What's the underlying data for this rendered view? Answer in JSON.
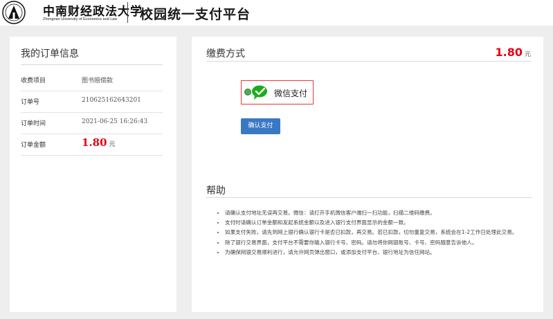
{
  "header": {
    "university_name_cn": "中南财经政法大学",
    "university_name_en": "Zhongnan University of Economics and Law",
    "platform_title": "校园统一支付平台"
  },
  "order_panel": {
    "title": "我的订单信息",
    "rows": [
      {
        "label": "收费项目",
        "value": "图书赔偿款"
      },
      {
        "label": "订单号",
        "value": "210625162643201"
      },
      {
        "label": "订单时间",
        "value": "2021-06-25 16:26:43"
      }
    ],
    "amount_label": "订单金额",
    "amount_value": "1.80",
    "amount_unit": "元"
  },
  "payment_panel": {
    "title": "缴费方式",
    "amount_value": "1.80",
    "amount_unit": "元",
    "method_label": "微信支付",
    "confirm_label": "确认支付"
  },
  "help": {
    "title": "帮助",
    "items": [
      "请确认支付地址无误再交易。微信：请打开手机微信客户端扫一扫功能，扫描二维码缴费。",
      "支付时请确认订单金额和发起系统金额以及进入银行支付界面显示的金额一致。",
      "如果支付失败，请先到网上银行确认银行卡是否已扣款，再交易。若已扣款，切勿重复交易，系统会在1-2工作日处理此交易。",
      "除了银行交易界面，支付平台不需要你输入银行卡号、密码。请勿将你网银账号、卡号、密码随意告诉他人。",
      "为确保网银交易顺利进行，请允许网页弹出窗口，或添加支付平台、银行地址为信任网站。"
    ]
  },
  "colors": {
    "accent_blue": "#3a78c4",
    "amount_red": "#e60012",
    "wechat_green": "#1aad19",
    "selection_border": "#e53935"
  },
  "icons": {
    "logo": "university-emblem-icon",
    "wechat": "wechat-icon",
    "radio": "radio-selected-icon"
  }
}
